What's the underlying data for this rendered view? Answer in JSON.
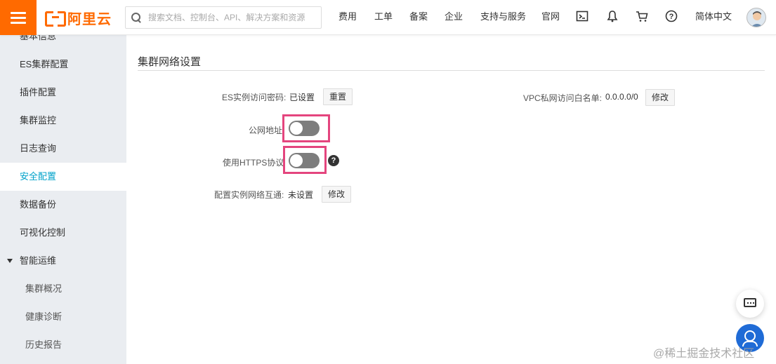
{
  "header": {
    "logo_text": "阿里云",
    "search_placeholder": "搜索文档、控制台、API、解决方案和资源",
    "nav": [
      "费用",
      "工单",
      "备案",
      "企业",
      "支持与服务",
      "官网"
    ],
    "language": "简体中文",
    "icons": [
      "terminal-icon",
      "bell-icon",
      "cart-icon",
      "help-icon"
    ],
    "accent_color": "#ff6a00"
  },
  "sidebar": {
    "items": [
      {
        "label": "基本信息"
      },
      {
        "label": "ES集群配置"
      },
      {
        "label": "插件配置"
      },
      {
        "label": "集群监控"
      },
      {
        "label": "日志查询"
      },
      {
        "label": "安全配置",
        "active": true
      },
      {
        "label": "数据备份"
      },
      {
        "label": "可视化控制"
      },
      {
        "label": "智能运维",
        "expanded": true
      },
      {
        "label": "集群概况"
      },
      {
        "label": "健康诊断"
      },
      {
        "label": "历史报告"
      }
    ],
    "active_color": "#00a2ca"
  },
  "main": {
    "section_title": "集群网络设置",
    "es_password": {
      "label": "ES实例访问密码:",
      "value": "已设置",
      "button": "重置"
    },
    "vpc_whitelist": {
      "label": "VPC私网访问白名单:",
      "value": "0.0.0.0/0",
      "button": "修改"
    },
    "public_address": {
      "label": "公网地址",
      "enabled": false
    },
    "https": {
      "label": "使用HTTPS协议",
      "enabled": false,
      "help": "?"
    },
    "network_interconnect": {
      "label": "配置实例网络互通:",
      "value": "未设置",
      "button": "修改"
    },
    "highlight_color": "#e4457e"
  },
  "watermark": "@稀土掘金技术社区"
}
